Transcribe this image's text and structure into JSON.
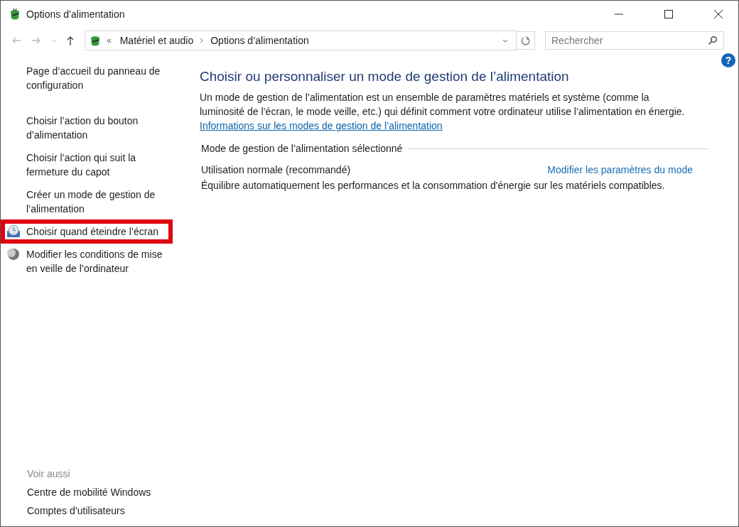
{
  "window": {
    "title": "Options d’alimentation"
  },
  "address_bar": {
    "overflow": "«",
    "path": [
      "Matériel et audio",
      "Options d’alimentation"
    ]
  },
  "search": {
    "placeholder": "Rechercher"
  },
  "help": "?",
  "sidebar": {
    "items": [
      {
        "label": "Page d’accueil du panneau de configuration",
        "kind": "plain",
        "highlighted": false
      },
      {
        "label": "Choisir l’action du bouton d’alimentation",
        "kind": "plain",
        "highlighted": false
      },
      {
        "label": "Choisir l’action qui suit la fermeture du capot",
        "kind": "plain",
        "highlighted": false
      },
      {
        "label": "Créer un mode de gestion de l’alimentation",
        "kind": "plain",
        "highlighted": false
      },
      {
        "label": "Choisir quand éteindre l’écran",
        "kind": "display",
        "highlighted": true
      },
      {
        "label": "Modifier les conditions de mise en veille de l’ordinateur",
        "kind": "sleep",
        "highlighted": false
      }
    ],
    "see_also": {
      "heading": "Voir aussi",
      "items": [
        "Centre de mobilité Windows",
        "Comptes d’utilisateurs"
      ]
    }
  },
  "main": {
    "title": "Choisir ou personnaliser un mode de gestion de l’alimentation",
    "description": "Un mode de gestion de l’alimentation est un ensemble de paramètres matériels et système (comme la luminosité de l’écran, le mode veille, etc.) qui définit comment votre ordinateur utilise l’alimentation en énergie.",
    "info_link": "Informations sur les modes de gestion de l’alimentation",
    "section_heading": "Mode de gestion de l’alimentation sélectionné",
    "plan": {
      "name": "Utilisation normale (recommandé)",
      "action": "Modifier les paramètres du mode",
      "description": "Équilibre automatiquement les performances et la consommation d'énergie sur les matériels compatibles."
    }
  }
}
